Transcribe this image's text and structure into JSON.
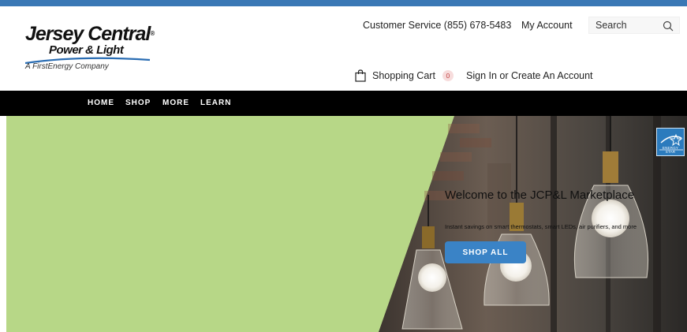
{
  "logo": {
    "line1": "Jersey Central",
    "line2": "Power & Light",
    "line3": "A FirstEnergy Company"
  },
  "header": {
    "customer_service": "Customer Service (855) 678-5483",
    "my_account": "My Account",
    "search_placeholder": "Search",
    "cart_label": "Shopping Cart",
    "cart_count": "0",
    "sign_in": "Sign In or Create An Account"
  },
  "nav": {
    "items": [
      {
        "label": "HOME"
      },
      {
        "label": "SHOP"
      },
      {
        "label": "MORE"
      },
      {
        "label": "LEARN"
      }
    ]
  },
  "hero": {
    "title": "Welcome to the JCP&L Marketplace",
    "subtitle": "Instant savings on smart thermostats, smart LEDs, air purifiers, and more",
    "button_label": "SHOP ALL",
    "badge_text": "ENERGY STAR"
  },
  "colors": {
    "top_bar": "#3a78b5",
    "nav_bg": "#000000",
    "hero_green": "#b7d787",
    "button_blue": "#3a83c6",
    "badge_blue": "#2b7bbd"
  }
}
